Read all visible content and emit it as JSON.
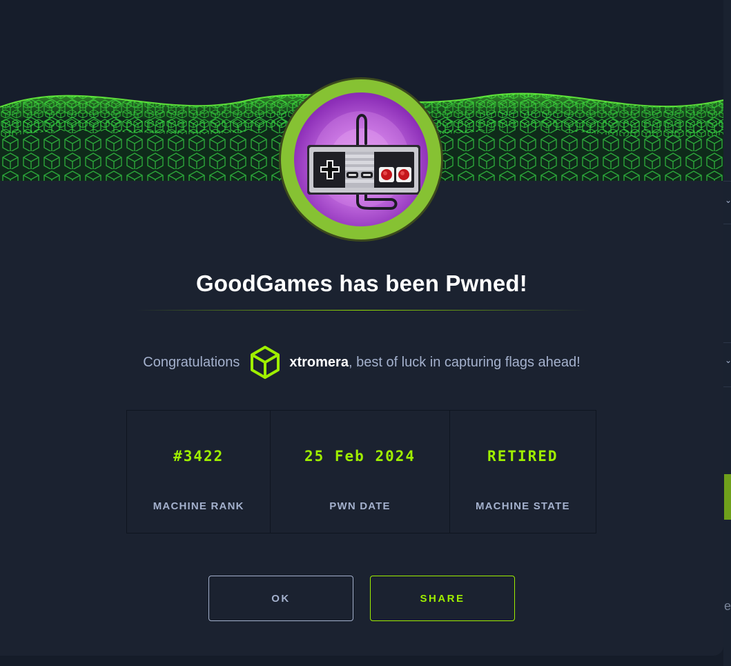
{
  "modal": {
    "title": "GoodGames has been Pwned!",
    "congrats_prefix": "Congratulations",
    "username": "xtromera",
    "congrats_suffix": ", best of luck in capturing flags ahead!",
    "avatar_icon": "nes-controller-icon",
    "user_icon": "hexagon-cube-icon"
  },
  "stats": [
    {
      "value": "#3422",
      "label": "MACHINE RANK"
    },
    {
      "value": "25 Feb 2024",
      "label": "PWN DATE"
    },
    {
      "value": "RETIRED",
      "label": "MACHINE STATE"
    }
  ],
  "buttons": {
    "ok": "OK",
    "share": "SHARE"
  },
  "background_page": {
    "edge_letter": "e"
  },
  "colors": {
    "accent": "#9fef00",
    "background": "#1b2230",
    "muted_text": "#a4b1cd",
    "avatar_ring": "#86c233"
  }
}
